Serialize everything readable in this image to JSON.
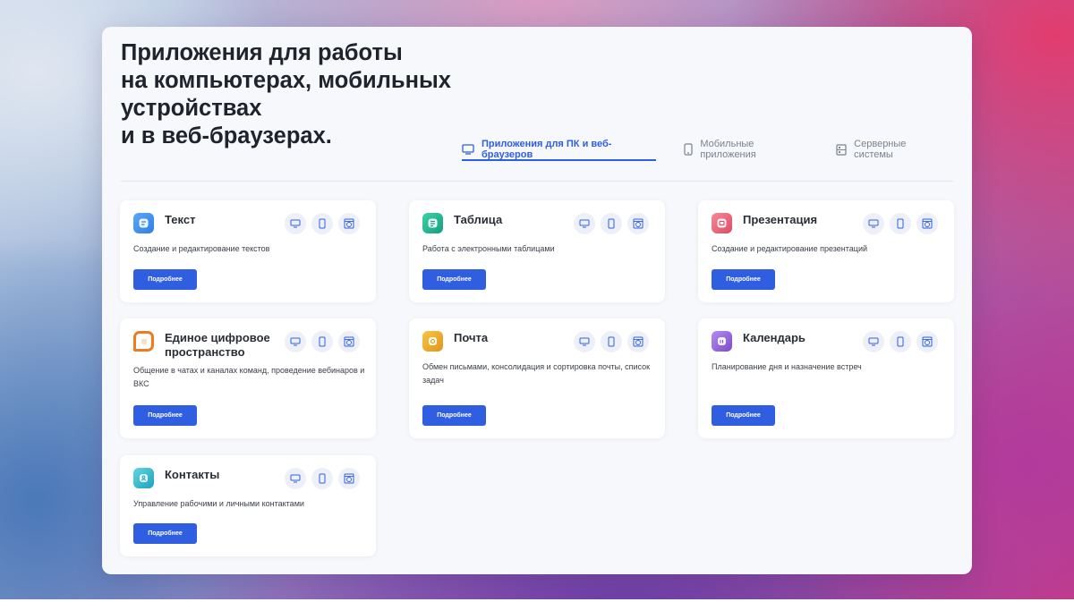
{
  "header": {
    "title_lines": [
      "Приложения для работы",
      "на компьютерах, мобильных",
      "устройствах",
      "и в веб-браузерах."
    ]
  },
  "tabs": [
    {
      "label": "Приложения для ПК и веб-браузеров",
      "icon": "desktop-icon",
      "active": true
    },
    {
      "label": "Мобильные приложения",
      "icon": "phone-icon",
      "active": false
    },
    {
      "label": "Серверные системы",
      "icon": "server-icon",
      "active": false
    }
  ],
  "more_label": "Подробнее",
  "platform_icons": [
    "desktop-icon",
    "phone-icon",
    "browser-icon"
  ],
  "colors": {
    "accent": "#2f5fe0",
    "text_logo": "#3c8ef0",
    "table_logo": "#18b48a",
    "presentation_logo": "#e8556a",
    "space_logo": "#f07a1e",
    "mail_logo": "#e8a41c",
    "calendar_logo": "#8a5cd6",
    "contacts_logo": "#2ab4c8"
  },
  "apps": [
    {
      "name": "Текст",
      "description": "Создание и редактирование текстов",
      "logo": "text-app-logo"
    },
    {
      "name": "Таблица",
      "description": "Работа с электронными таблицами",
      "logo": "table-app-logo"
    },
    {
      "name": "Презентация",
      "description": "Создание и редактирование презентаций",
      "logo": "presentation-app-logo"
    },
    {
      "name": "Единое цифровое пространство",
      "description": "Общение в чатах и каналах команд, проведение вебинаров и ВКС",
      "logo": "space-app-logo"
    },
    {
      "name": "Почта",
      "description": "Обмен письмами, консолидация и сортировка почты, список задач",
      "logo": "mail-app-logo"
    },
    {
      "name": "Календарь",
      "description": "Планирование дня и назначение встреч",
      "logo": "calendar-app-logo"
    },
    {
      "name": "Контакты",
      "description": "Управление рабочими и личными контактами",
      "logo": "contacts-app-logo"
    }
  ]
}
